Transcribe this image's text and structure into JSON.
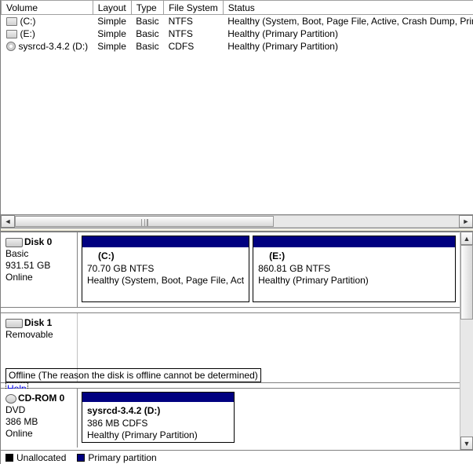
{
  "columns": {
    "volume": "Volume",
    "layout": "Layout",
    "type": "Type",
    "filesystem": "File System",
    "status": "Status"
  },
  "volumes": [
    {
      "icon": "drive",
      "name": "(C:)",
      "layout": "Simple",
      "type": "Basic",
      "fs": "NTFS",
      "status": "Healthy (System, Boot, Page File, Active, Crash Dump, Primar"
    },
    {
      "icon": "drive",
      "name": "(E:)",
      "layout": "Simple",
      "type": "Basic",
      "fs": "NTFS",
      "status": "Healthy (Primary Partition)"
    },
    {
      "icon": "disc",
      "name": "sysrcd-3.4.2 (D:)",
      "layout": "Simple",
      "type": "Basic",
      "fs": "CDFS",
      "status": "Healthy (Primary Partition)"
    }
  ],
  "disks": {
    "d0": {
      "title": "Disk 0",
      "type": "Basic",
      "size": "931.51 GB",
      "state": "Online",
      "parts": [
        {
          "title": "(C:)",
          "line2": "70.70 GB NTFS",
          "line3": "Healthy (System, Boot, Page File, Act"
        },
        {
          "title": "(E:)",
          "line2": "860.81 GB NTFS",
          "line3": "Healthy (Primary Partition)"
        }
      ]
    },
    "d1": {
      "title": "Disk 1",
      "type": "Removable",
      "size": "",
      "offline_text": "Offline (The reason the disk is offline cannot be determined)",
      "help": "Help"
    },
    "cd0": {
      "title": "CD-ROM 0",
      "type": "DVD",
      "size": "386 MB",
      "state": "Online",
      "parts": [
        {
          "title": "sysrcd-3.4.2 (D:)",
          "line2": "386 MB CDFS",
          "line3": "Healthy (Primary Partition)"
        }
      ]
    }
  },
  "legend": {
    "unallocated": "Unallocated",
    "primary": "Primary partition"
  }
}
